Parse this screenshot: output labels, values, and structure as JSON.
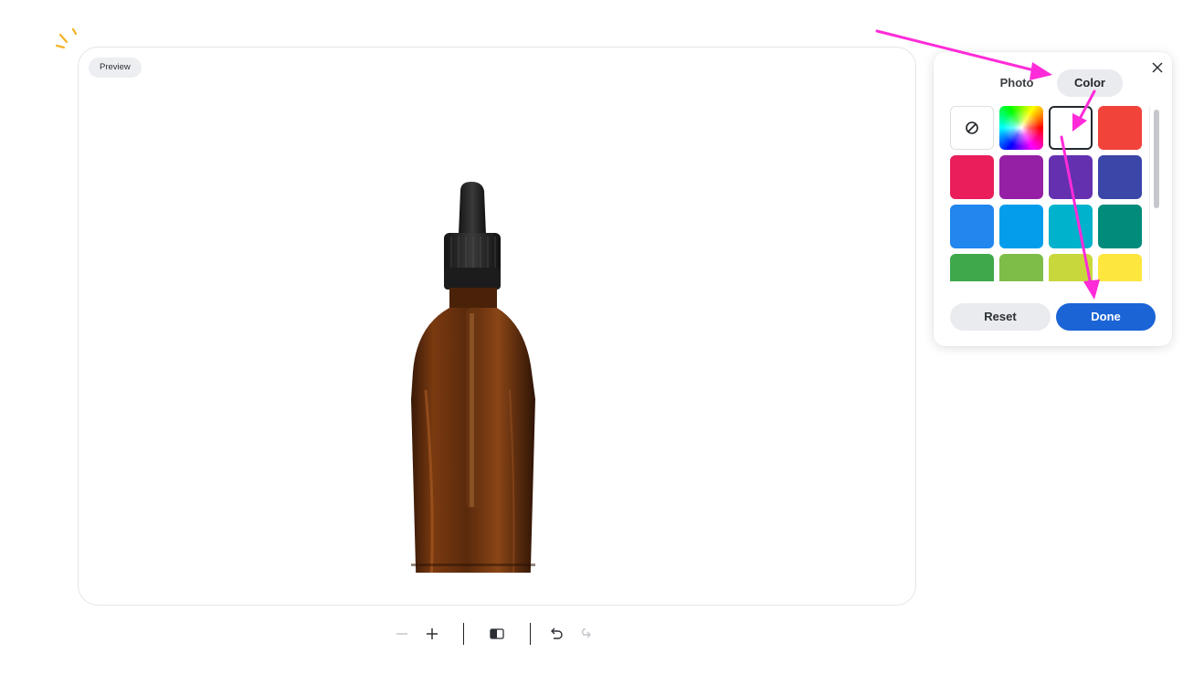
{
  "canvas": {
    "preview_label": "Preview"
  },
  "toolbar": {
    "icons": [
      "zoom-out-icon",
      "zoom-in-icon",
      "compare-icon",
      "undo-icon",
      "redo-icon"
    ]
  },
  "panel": {
    "tabs": [
      {
        "label": "Photo",
        "selected": false
      },
      {
        "label": "Color",
        "selected": true
      }
    ],
    "swatches": [
      {
        "name": "none",
        "color": ""
      },
      {
        "name": "rainbow",
        "color": ""
      },
      {
        "name": "white",
        "color": "#ffffff",
        "selected": true
      },
      {
        "name": "red",
        "color": "#f2433a"
      },
      {
        "name": "pink",
        "color": "#e91e5a"
      },
      {
        "name": "purple",
        "color": "#951fa5"
      },
      {
        "name": "deep-purple",
        "color": "#6430b0"
      },
      {
        "name": "indigo",
        "color": "#3a46a8"
      },
      {
        "name": "blue",
        "color": "#2186ee"
      },
      {
        "name": "light-blue",
        "color": "#049dec"
      },
      {
        "name": "cyan",
        "color": "#00b2cb"
      },
      {
        "name": "teal",
        "color": "#018b7b"
      },
      {
        "name": "green",
        "color": "#3ea84a"
      },
      {
        "name": "light-green",
        "color": "#7ebd48"
      },
      {
        "name": "lime",
        "color": "#c8d83c"
      },
      {
        "name": "yellow",
        "color": "#fde73f"
      }
    ],
    "reset_label": "Reset",
    "done_label": "Done"
  },
  "colors": {
    "accent": "#1a64d6",
    "annotation_arrow": "#ff2bd8",
    "sparkle": "#f5b324"
  }
}
